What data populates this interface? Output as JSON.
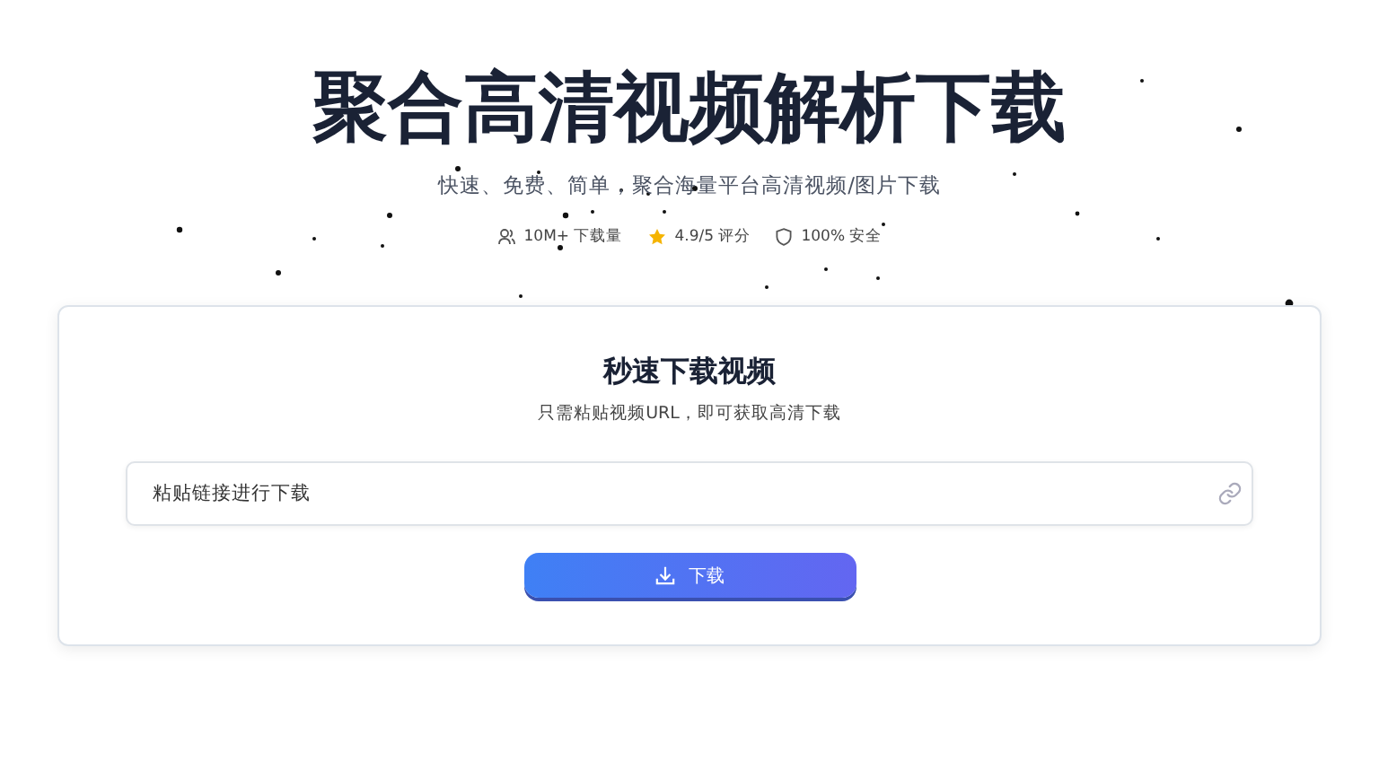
{
  "header": {
    "title": "聚合高清视频解析下载",
    "subtitle": "快速、免费、简单，聚合海量平台高清视频/图片下载",
    "stats": [
      {
        "kind": "users",
        "text": "10M+ 下载量"
      },
      {
        "kind": "star",
        "text": "4.9/5 评分"
      },
      {
        "kind": "shield",
        "text": "100% 安全"
      }
    ]
  },
  "card": {
    "title": "秒速下载视频",
    "subtitle": "只需粘贴视频URL，即可获取高清下载",
    "input": {
      "placeholder": "粘贴链接进行下载"
    },
    "button": "下载"
  }
}
